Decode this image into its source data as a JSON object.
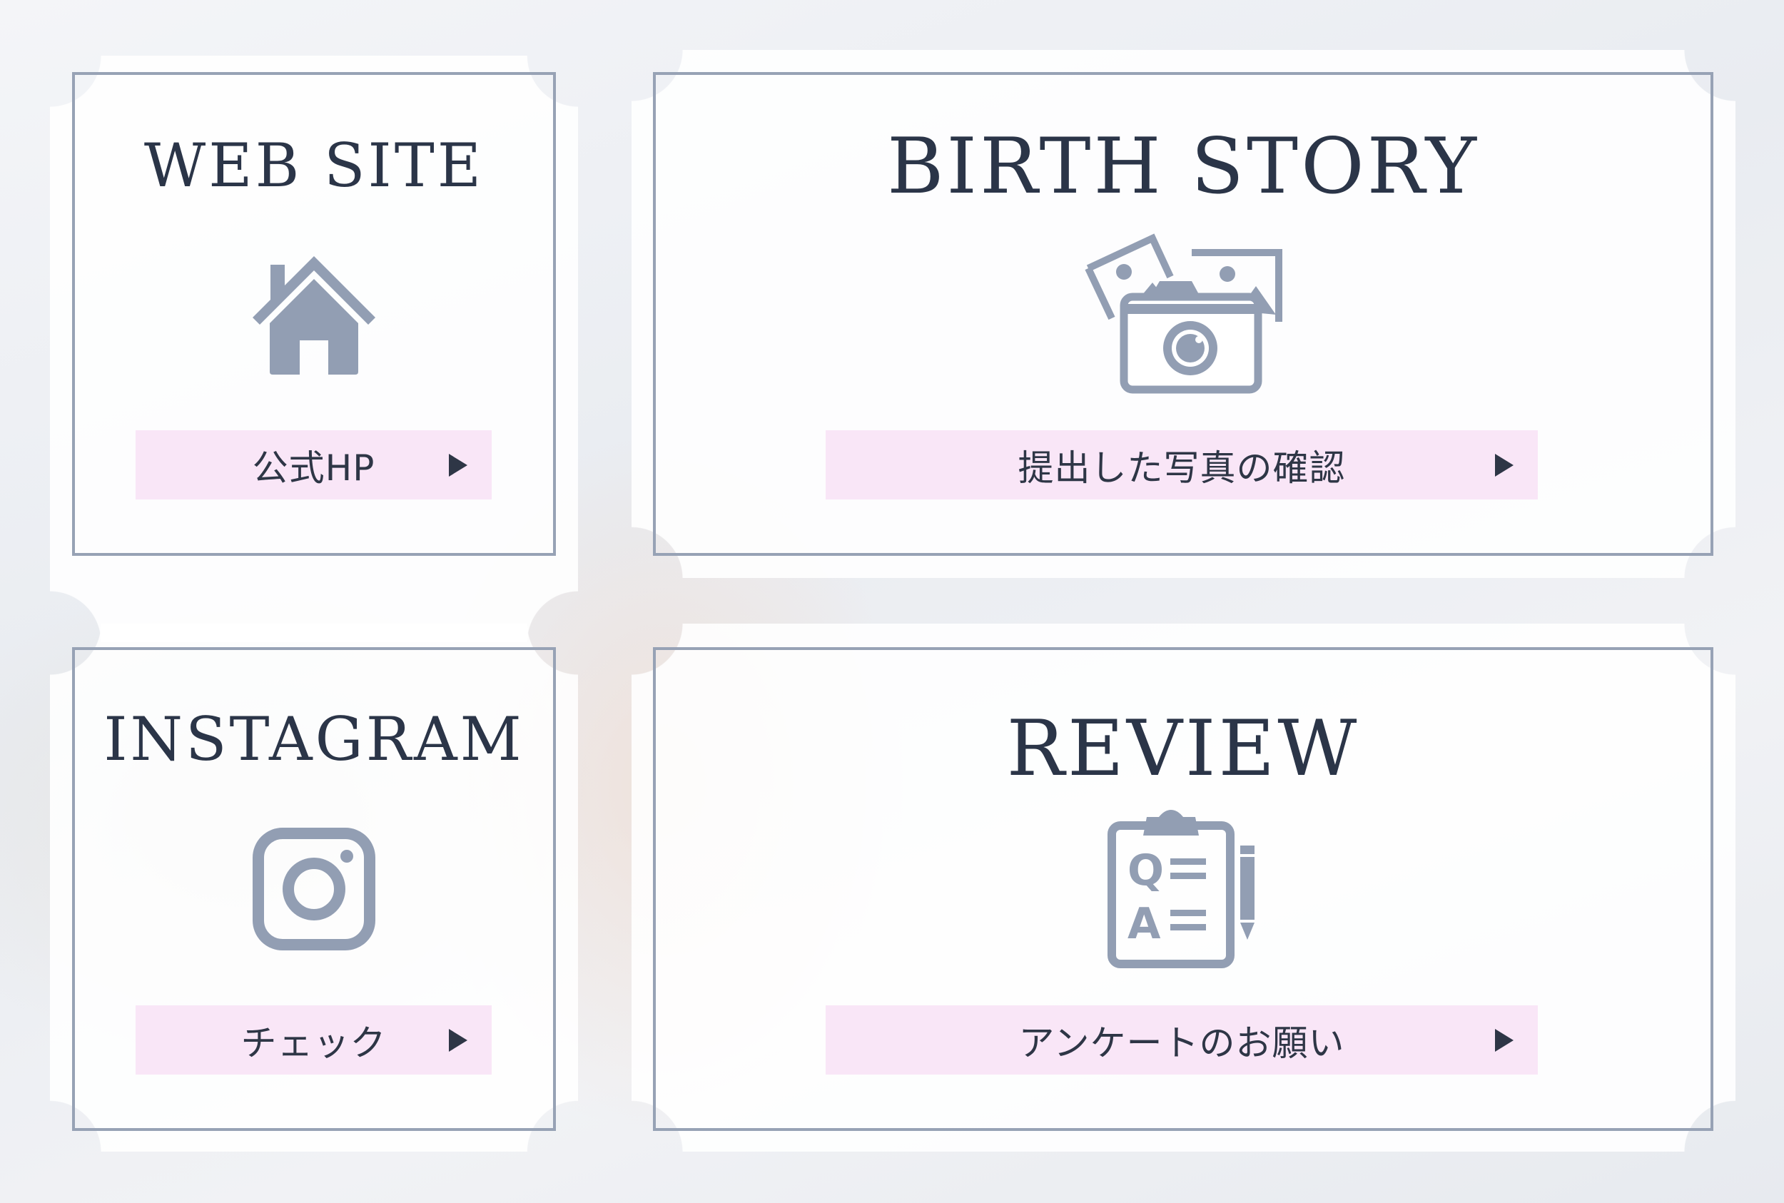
{
  "cards": [
    {
      "title": "WEB SITE",
      "icon": "house-icon",
      "button": "公式HP"
    },
    {
      "title": "BIRTH STORY",
      "icon": "camera-photos-icon",
      "button": "提出した写真の確認"
    },
    {
      "title": "INSTAGRAM",
      "icon": "instagram-icon",
      "button": "チェック"
    },
    {
      "title": "REVIEW",
      "icon": "qa-clipboard-icon",
      "button": "アンケートのお願い"
    }
  ],
  "colors": {
    "title": "#2b3548",
    "icon": "#929eb3",
    "button_bg": "#f9e6f7",
    "frame": "#97a2b5"
  }
}
